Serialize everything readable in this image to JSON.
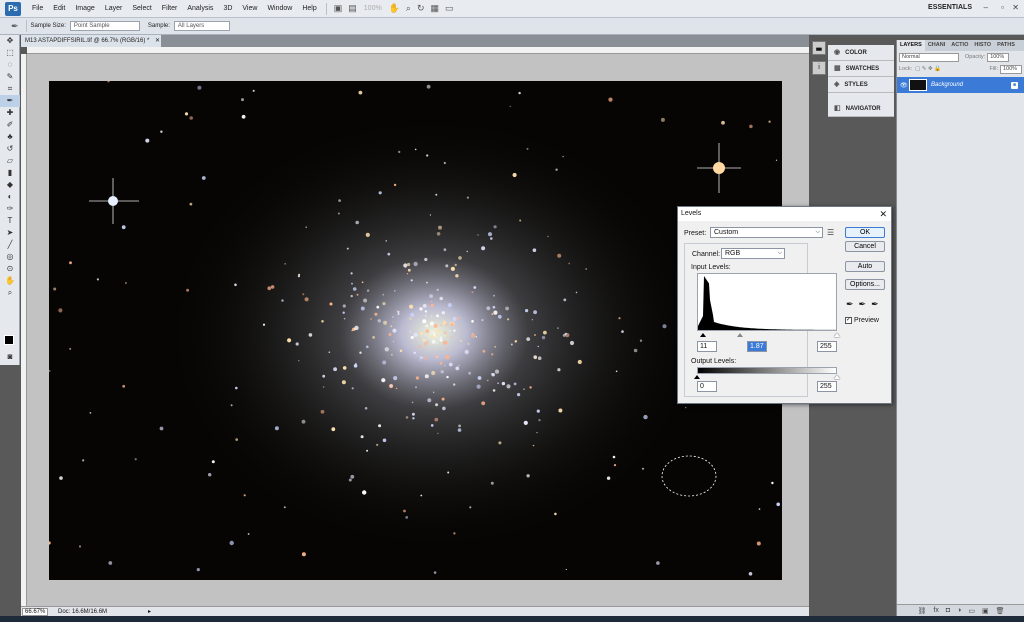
{
  "menubar": {
    "logo": "Ps",
    "items": [
      "File",
      "Edit",
      "Image",
      "Layer",
      "Select",
      "Filter",
      "Analysis",
      "3D",
      "View",
      "Window",
      "Help"
    ],
    "zoom": "100%",
    "workspace": "ESSENTIALS"
  },
  "options": {
    "sample_size_label": "Sample Size:",
    "sample_size_value": "Point Sample",
    "sample_label": "Sample:",
    "sample_value": "All Layers"
  },
  "document": {
    "tab_title": "M13 ASTAPDIFFSIRIL.tif @ 66.7% (RGB/16) *",
    "zoom_display": "66.67%",
    "doc_info": "Doc: 16.6M/16.6M"
  },
  "panels": {
    "color": "COLOR",
    "swatches": "SWATCHES",
    "styles": "STYLES",
    "navigator": "NAVIGATOR"
  },
  "layers": {
    "tabs": [
      "LAYERS",
      "CHANI",
      "ACTIO",
      "HISTO",
      "PATHS"
    ],
    "blend_mode": "Normal",
    "opacity_label": "Opacity:",
    "opacity": "100%",
    "lock_label": "Lock:",
    "fill_label": "Fill:",
    "fill": "100%",
    "layer_name": "Background"
  },
  "levels": {
    "title": "Levels",
    "preset_label": "Preset:",
    "preset_value": "Custom",
    "channel_label": "Channel:",
    "channel_value": "RGB",
    "input_label": "Input Levels:",
    "input_black": "11",
    "input_gamma": "1.87",
    "input_white": "255",
    "output_label": "Output Levels:",
    "output_black": "0",
    "output_white": "255",
    "buttons": {
      "ok": "OK",
      "cancel": "Cancel",
      "auto": "Auto",
      "options": "Options..."
    },
    "preview_label": "Preview",
    "preview_checked": true
  }
}
